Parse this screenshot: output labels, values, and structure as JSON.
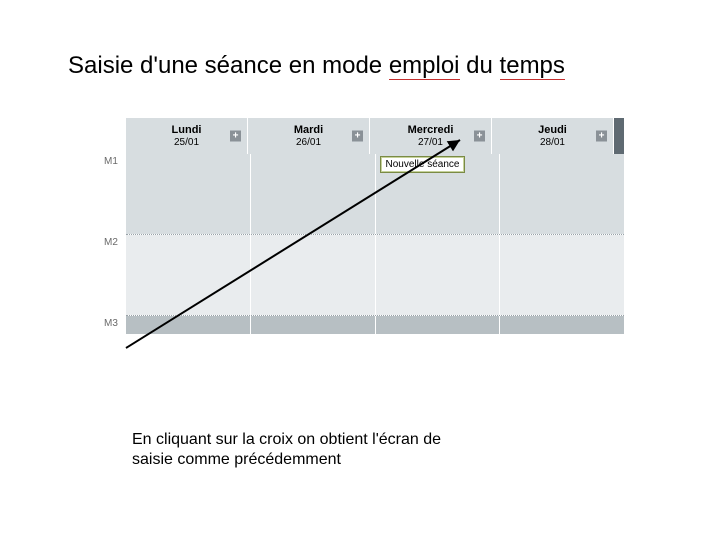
{
  "title": {
    "prefix": "Saisie d'une séance en mode ",
    "underlined1": "emploi",
    "mid": " du ",
    "underlined2": "temps"
  },
  "days": [
    {
      "name": "Lundi",
      "date": "25/01"
    },
    {
      "name": "Mardi",
      "date": "26/01"
    },
    {
      "name": "Mercredi",
      "date": "27/01"
    },
    {
      "name": "Jeudi",
      "date": "28/01"
    }
  ],
  "rows": [
    {
      "id": "M1"
    },
    {
      "id": "M2"
    },
    {
      "id": "M3"
    }
  ],
  "tooltip": "Nouvelle séance",
  "plus_glyph": "+",
  "caption": "En cliquant sur la croix on obtient l'écran de saisie  comme précédemment"
}
